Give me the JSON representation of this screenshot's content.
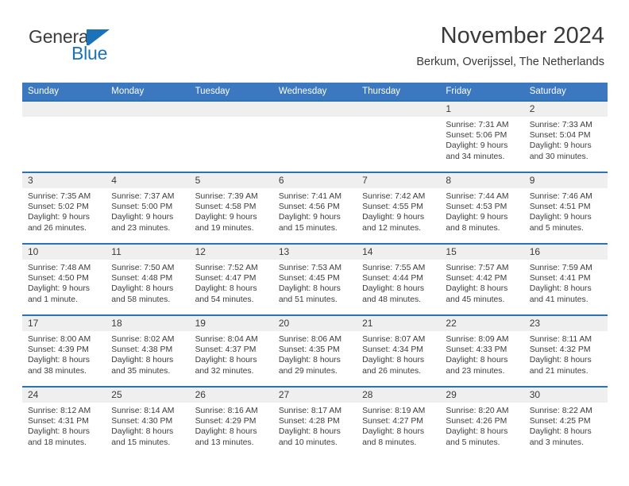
{
  "brand": {
    "name_part1": "General",
    "name_part2": "Blue",
    "logo_icon": "blue-flag-triangle-icon",
    "accent_color": "#1b72b8"
  },
  "header": {
    "title": "November 2024",
    "subtitle": "Berkum, Overijssel, The Netherlands"
  },
  "theme": {
    "header_bar_color": "#3b78bf",
    "cell_top_border_color": "#2f72b4",
    "day_band_color": "#efefef"
  },
  "weekdays": [
    "Sunday",
    "Monday",
    "Tuesday",
    "Wednesday",
    "Thursday",
    "Friday",
    "Saturday"
  ],
  "weeks": [
    [
      {
        "day": "",
        "empty": true,
        "lines": []
      },
      {
        "day": "",
        "empty": true,
        "lines": []
      },
      {
        "day": "",
        "empty": true,
        "lines": []
      },
      {
        "day": "",
        "empty": true,
        "lines": []
      },
      {
        "day": "",
        "empty": true,
        "lines": []
      },
      {
        "day": "1",
        "empty": false,
        "lines": [
          "Sunrise: 7:31 AM",
          "Sunset: 5:06 PM",
          "Daylight: 9 hours",
          "and 34 minutes."
        ]
      },
      {
        "day": "2",
        "empty": false,
        "lines": [
          "Sunrise: 7:33 AM",
          "Sunset: 5:04 PM",
          "Daylight: 9 hours",
          "and 30 minutes."
        ]
      }
    ],
    [
      {
        "day": "3",
        "empty": false,
        "lines": [
          "Sunrise: 7:35 AM",
          "Sunset: 5:02 PM",
          "Daylight: 9 hours",
          "and 26 minutes."
        ]
      },
      {
        "day": "4",
        "empty": false,
        "lines": [
          "Sunrise: 7:37 AM",
          "Sunset: 5:00 PM",
          "Daylight: 9 hours",
          "and 23 minutes."
        ]
      },
      {
        "day": "5",
        "empty": false,
        "lines": [
          "Sunrise: 7:39 AM",
          "Sunset: 4:58 PM",
          "Daylight: 9 hours",
          "and 19 minutes."
        ]
      },
      {
        "day": "6",
        "empty": false,
        "lines": [
          "Sunrise: 7:41 AM",
          "Sunset: 4:56 PM",
          "Daylight: 9 hours",
          "and 15 minutes."
        ]
      },
      {
        "day": "7",
        "empty": false,
        "lines": [
          "Sunrise: 7:42 AM",
          "Sunset: 4:55 PM",
          "Daylight: 9 hours",
          "and 12 minutes."
        ]
      },
      {
        "day": "8",
        "empty": false,
        "lines": [
          "Sunrise: 7:44 AM",
          "Sunset: 4:53 PM",
          "Daylight: 9 hours",
          "and 8 minutes."
        ]
      },
      {
        "day": "9",
        "empty": false,
        "lines": [
          "Sunrise: 7:46 AM",
          "Sunset: 4:51 PM",
          "Daylight: 9 hours",
          "and 5 minutes."
        ]
      }
    ],
    [
      {
        "day": "10",
        "empty": false,
        "lines": [
          "Sunrise: 7:48 AM",
          "Sunset: 4:50 PM",
          "Daylight: 9 hours",
          "and 1 minute."
        ]
      },
      {
        "day": "11",
        "empty": false,
        "lines": [
          "Sunrise: 7:50 AM",
          "Sunset: 4:48 PM",
          "Daylight: 8 hours",
          "and 58 minutes."
        ]
      },
      {
        "day": "12",
        "empty": false,
        "lines": [
          "Sunrise: 7:52 AM",
          "Sunset: 4:47 PM",
          "Daylight: 8 hours",
          "and 54 minutes."
        ]
      },
      {
        "day": "13",
        "empty": false,
        "lines": [
          "Sunrise: 7:53 AM",
          "Sunset: 4:45 PM",
          "Daylight: 8 hours",
          "and 51 minutes."
        ]
      },
      {
        "day": "14",
        "empty": false,
        "lines": [
          "Sunrise: 7:55 AM",
          "Sunset: 4:44 PM",
          "Daylight: 8 hours",
          "and 48 minutes."
        ]
      },
      {
        "day": "15",
        "empty": false,
        "lines": [
          "Sunrise: 7:57 AM",
          "Sunset: 4:42 PM",
          "Daylight: 8 hours",
          "and 45 minutes."
        ]
      },
      {
        "day": "16",
        "empty": false,
        "lines": [
          "Sunrise: 7:59 AM",
          "Sunset: 4:41 PM",
          "Daylight: 8 hours",
          "and 41 minutes."
        ]
      }
    ],
    [
      {
        "day": "17",
        "empty": false,
        "lines": [
          "Sunrise: 8:00 AM",
          "Sunset: 4:39 PM",
          "Daylight: 8 hours",
          "and 38 minutes."
        ]
      },
      {
        "day": "18",
        "empty": false,
        "lines": [
          "Sunrise: 8:02 AM",
          "Sunset: 4:38 PM",
          "Daylight: 8 hours",
          "and 35 minutes."
        ]
      },
      {
        "day": "19",
        "empty": false,
        "lines": [
          "Sunrise: 8:04 AM",
          "Sunset: 4:37 PM",
          "Daylight: 8 hours",
          "and 32 minutes."
        ]
      },
      {
        "day": "20",
        "empty": false,
        "lines": [
          "Sunrise: 8:06 AM",
          "Sunset: 4:35 PM",
          "Daylight: 8 hours",
          "and 29 minutes."
        ]
      },
      {
        "day": "21",
        "empty": false,
        "lines": [
          "Sunrise: 8:07 AM",
          "Sunset: 4:34 PM",
          "Daylight: 8 hours",
          "and 26 minutes."
        ]
      },
      {
        "day": "22",
        "empty": false,
        "lines": [
          "Sunrise: 8:09 AM",
          "Sunset: 4:33 PM",
          "Daylight: 8 hours",
          "and 23 minutes."
        ]
      },
      {
        "day": "23",
        "empty": false,
        "lines": [
          "Sunrise: 8:11 AM",
          "Sunset: 4:32 PM",
          "Daylight: 8 hours",
          "and 21 minutes."
        ]
      }
    ],
    [
      {
        "day": "24",
        "empty": false,
        "lines": [
          "Sunrise: 8:12 AM",
          "Sunset: 4:31 PM",
          "Daylight: 8 hours",
          "and 18 minutes."
        ]
      },
      {
        "day": "25",
        "empty": false,
        "lines": [
          "Sunrise: 8:14 AM",
          "Sunset: 4:30 PM",
          "Daylight: 8 hours",
          "and 15 minutes."
        ]
      },
      {
        "day": "26",
        "empty": false,
        "lines": [
          "Sunrise: 8:16 AM",
          "Sunset: 4:29 PM",
          "Daylight: 8 hours",
          "and 13 minutes."
        ]
      },
      {
        "day": "27",
        "empty": false,
        "lines": [
          "Sunrise: 8:17 AM",
          "Sunset: 4:28 PM",
          "Daylight: 8 hours",
          "and 10 minutes."
        ]
      },
      {
        "day": "28",
        "empty": false,
        "lines": [
          "Sunrise: 8:19 AM",
          "Sunset: 4:27 PM",
          "Daylight: 8 hours",
          "and 8 minutes."
        ]
      },
      {
        "day": "29",
        "empty": false,
        "lines": [
          "Sunrise: 8:20 AM",
          "Sunset: 4:26 PM",
          "Daylight: 8 hours",
          "and 5 minutes."
        ]
      },
      {
        "day": "30",
        "empty": false,
        "lines": [
          "Sunrise: 8:22 AM",
          "Sunset: 4:25 PM",
          "Daylight: 8 hours",
          "and 3 minutes."
        ]
      }
    ]
  ]
}
